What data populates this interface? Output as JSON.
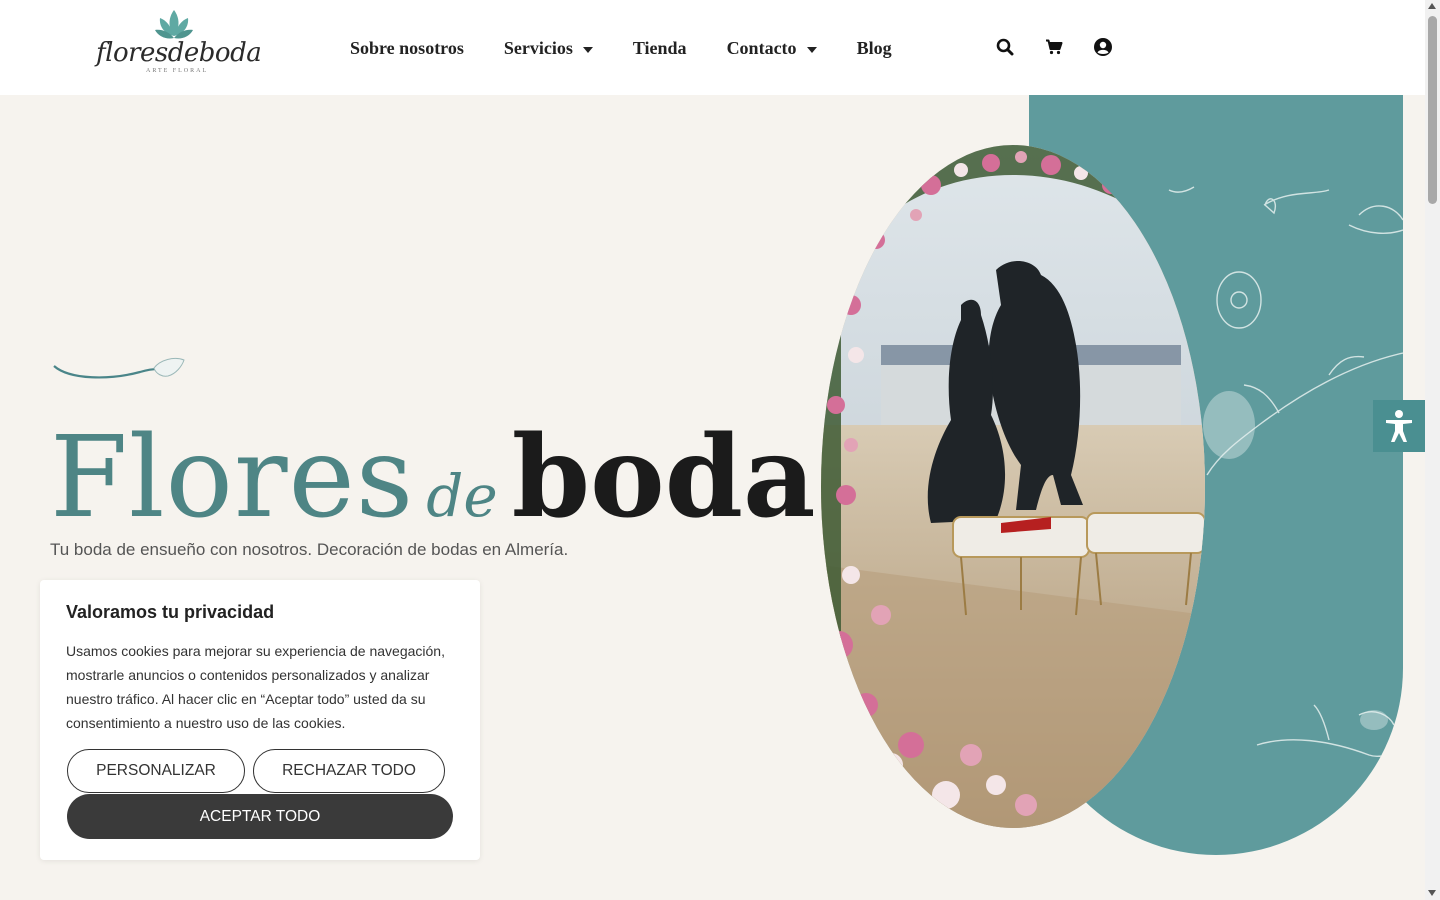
{
  "brand": {
    "logo_text": "floresdeboda",
    "tagline": "ARTE FLORAL"
  },
  "nav": {
    "items": [
      {
        "label": "Sobre nosotros",
        "dropdown": false
      },
      {
        "label": "Servicios",
        "dropdown": true
      },
      {
        "label": "Tienda",
        "dropdown": false
      },
      {
        "label": "Contacto",
        "dropdown": true
      },
      {
        "label": "Blog",
        "dropdown": false
      }
    ],
    "icons": [
      "search-icon",
      "cart-icon",
      "user-account-icon"
    ]
  },
  "hero": {
    "title_part1": "Flores",
    "title_part2": "de",
    "title_part3": "boda",
    "subtitle": "Tu boda de ensueño con nosotros. Decoración de bodas en Almería.",
    "image_alt": "wedding-arch-photo"
  },
  "cookie": {
    "title": "Valoramos tu privacidad",
    "text": "Usamos cookies para mejorar su experiencia de navegación, mostrarle anuncios o contenidos personalizados y analizar nuestro tráfico. Al hacer clic en “Aceptar todo” usted da su consentimiento a nuestro uso de las cookies.",
    "customize_label": "PERSONALIZAR",
    "reject_label": "RECHAZAR TODO",
    "accept_label": "ACEPTAR TODO"
  },
  "colors": {
    "teal": "#5f9b9d",
    "title_teal": "#4e8585",
    "background": "#f6f3ee",
    "dark_button": "#3a3a3a"
  }
}
